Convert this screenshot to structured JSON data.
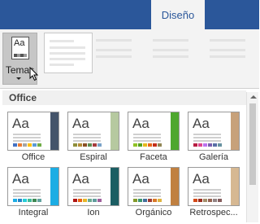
{
  "ribbon": {
    "active_tab": "Diseño"
  },
  "themes_button": {
    "label": "Temas",
    "icon_text": "Aa"
  },
  "gallery": {
    "section_title": "Office",
    "themes": [
      {
        "label": "Office",
        "icon_text": "Aa",
        "accent": "#44546a",
        "swatches": [
          "#4472c4",
          "#ed7d31",
          "#a5a5a5",
          "#ffc000",
          "#5b9bd5",
          "#70ad47"
        ]
      },
      {
        "label": "Espiral",
        "icon_text": "Aa",
        "accent": "#b6c9a0",
        "swatches": [
          "#8f8f3b",
          "#b38c36",
          "#8b4f24",
          "#5e8d4f",
          "#a63c3c",
          "#7aa2c8"
        ]
      },
      {
        "label": "Faceta",
        "icon_text": "Aa",
        "accent": "#4ea72e",
        "swatches": [
          "#90c226",
          "#54a021",
          "#e6b91e",
          "#e76618",
          "#c42f1a",
          "#918655"
        ]
      },
      {
        "label": "Galería",
        "icon_text": "Aa",
        "accent": "#c7a17a",
        "swatches": [
          "#b71e42",
          "#de478e",
          "#bc72f0",
          "#795faf",
          "#586ea6",
          "#6892a0"
        ]
      },
      {
        "label": "Integral",
        "icon_text": "Aa",
        "accent": "#1cade4",
        "swatches": [
          "#1cade4",
          "#2683c6",
          "#27ced7",
          "#42ba97",
          "#3e8853",
          "#62a39f"
        ]
      },
      {
        "label": "Ion",
        "icon_text": "Aa",
        "accent": "#1b5e63",
        "swatches": [
          "#b01513",
          "#ea6312",
          "#e6b729",
          "#6aac90",
          "#5f9c9d",
          "#9e5e9b"
        ]
      },
      {
        "label": "Orgánico",
        "icon_text": "Aa",
        "accent": "#c08040",
        "swatches": [
          "#83992a",
          "#3c9770",
          "#44709d",
          "#a23c33",
          "#d97828",
          "#deb340"
        ]
      },
      {
        "label": "Retrospec...",
        "icon_text": "Aa",
        "accent": "#d6b892",
        "swatches": [
          "#d34817",
          "#9b2d1f",
          "#a28e6a",
          "#956251",
          "#918485",
          "#855d5d"
        ]
      }
    ]
  }
}
